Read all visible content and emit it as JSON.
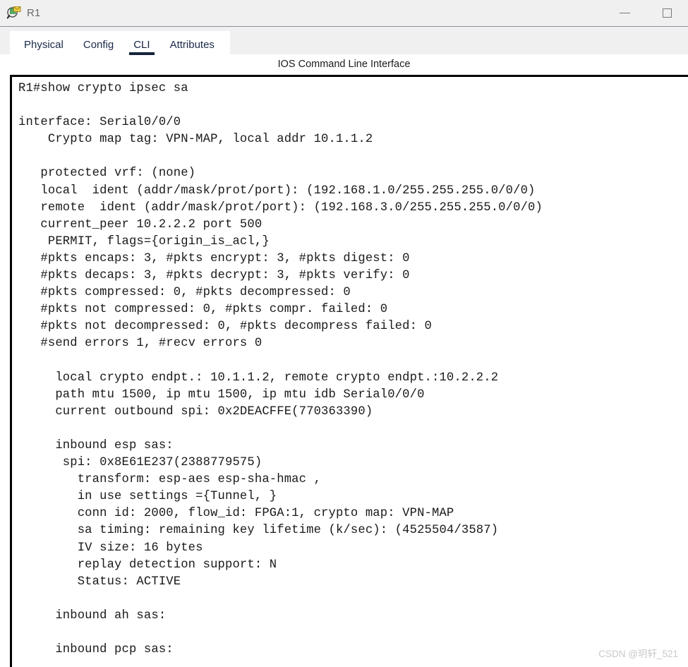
{
  "window": {
    "title": "R1",
    "icon": "packet-tracer-inspect-icon",
    "controls": {
      "minimize": "—",
      "maximize": "□"
    }
  },
  "tabs": [
    {
      "label": "Physical",
      "active": false
    },
    {
      "label": "Config",
      "active": false
    },
    {
      "label": "CLI",
      "active": true
    },
    {
      "label": "Attributes",
      "active": false
    }
  ],
  "panel": {
    "header": "IOS Command Line Interface"
  },
  "terminal": {
    "prompt": "R1#",
    "command": "show crypto ipsec sa",
    "content": "R1#show crypto ipsec sa\n\ninterface: Serial0/0/0\n    Crypto map tag: VPN-MAP, local addr 10.1.1.2\n\n   protected vrf: (none)\n   local  ident (addr/mask/prot/port): (192.168.1.0/255.255.255.0/0/0)\n   remote  ident (addr/mask/prot/port): (192.168.3.0/255.255.255.0/0/0)\n   current_peer 10.2.2.2 port 500\n    PERMIT, flags={origin_is_acl,}\n   #pkts encaps: 3, #pkts encrypt: 3, #pkts digest: 0\n   #pkts decaps: 3, #pkts decrypt: 3, #pkts verify: 0\n   #pkts compressed: 0, #pkts decompressed: 0\n   #pkts not compressed: 0, #pkts compr. failed: 0\n   #pkts not decompressed: 0, #pkts decompress failed: 0\n   #send errors 1, #recv errors 0\n\n     local crypto endpt.: 10.1.1.2, remote crypto endpt.:10.2.2.2\n     path mtu 1500, ip mtu 1500, ip mtu idb Serial0/0/0\n     current outbound spi: 0x2DEACFFE(770363390)\n\n     inbound esp sas:\n      spi: 0x8E61E237(2388779575)\n        transform: esp-aes esp-sha-hmac ,\n        in use settings ={Tunnel, }\n        conn id: 2000, flow_id: FPGA:1, crypto map: VPN-MAP\n        sa timing: remaining key lifetime (k/sec): (4525504/3587)\n        IV size: 16 bytes\n        replay detection support: N\n        Status: ACTIVE\n\n     inbound ah sas:\n\n     inbound pcp sas:",
    "values": {
      "interface": "Serial0/0/0",
      "crypto_map_tag": "VPN-MAP",
      "local_addr": "10.1.1.2",
      "protected_vrf": "(none)",
      "local_ident": "(192.168.1.0/255.255.255.0/0/0)",
      "remote_ident": "(192.168.3.0/255.255.255.0/0/0)",
      "current_peer": "10.2.2.2",
      "peer_port": "500",
      "flags": "{origin_is_acl,}",
      "pkts_encaps": "3",
      "pkts_encrypt": "3",
      "pkts_digest": "0",
      "pkts_decaps": "3",
      "pkts_decrypt": "3",
      "pkts_verify": "0",
      "pkts_compressed": "0",
      "pkts_decompressed": "0",
      "pkts_not_compressed": "0",
      "pkts_compr_failed": "0",
      "pkts_not_decompressed": "0",
      "pkts_decompress_failed": "0",
      "send_errors": "1",
      "recv_errors": "0",
      "local_crypto_endpt": "10.1.1.2",
      "remote_crypto_endpt": "10.2.2.2",
      "path_mtu": "1500",
      "ip_mtu": "1500",
      "ip_mtu_idb": "Serial0/0/0",
      "current_outbound_spi": "0x2DEACFFE(770363390)",
      "inbound_esp_spi": "0x8E61E237(2388779575)",
      "transform": "esp-aes esp-sha-hmac ,",
      "in_use_settings": "={Tunnel, }",
      "conn_id": "2000",
      "flow_id": "FPGA:1",
      "crypto_map": "VPN-MAP",
      "sa_timing_lifetime": "(4525504/3587)",
      "iv_size": "16 bytes",
      "replay_detection_support": "N",
      "status": "ACTIVE"
    }
  },
  "watermark": {
    "text": "CSDN @玥轩_521"
  },
  "colors": {
    "chrome_bg": "#f0f0f0",
    "tab_text": "#1b2a4a",
    "tab_underline": "#16243c",
    "terminal_bg": "#ffffff",
    "terminal_text": "#1a1a1a",
    "terminal_border": "#000000",
    "watermark": "#c9c9c9"
  }
}
